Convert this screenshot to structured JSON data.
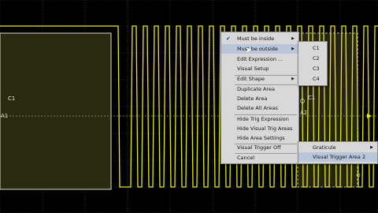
{
  "colors": {
    "background": "#000000",
    "grid": "#4a4a38",
    "signal": "#e8e820",
    "area_fill": "#2a2a10",
    "menu_bg": "#d8d8d8",
    "menu_highlight": "#b9c5d9"
  },
  "labels": {
    "area1_channel": "C1",
    "area1_marker": "A1",
    "area2_channel": "C1",
    "area2_marker": "A2"
  },
  "context_menu": {
    "items": [
      {
        "label": "Must be inside",
        "checked": true,
        "submenu": true
      },
      {
        "label": "Must be outside",
        "highlighted": true,
        "submenu": true
      },
      {
        "label": "Edit Expression ..."
      },
      {
        "label": "Visual Setup"
      },
      {
        "label": "Edit Shape",
        "submenu": true
      },
      {
        "label": "Duplicate Area"
      },
      {
        "label": "Delete Area"
      },
      {
        "label": "Delete All Areas"
      },
      {
        "label": "Hide Trig Expression"
      },
      {
        "label": "Hide Visual Trig Areas"
      },
      {
        "label": "Hide Area Settings"
      },
      {
        "label": "Visual Trigger Off"
      },
      {
        "label": "Cancel"
      }
    ]
  },
  "channel_submenu": {
    "items": [
      "C1",
      "C2",
      "C3",
      "C4"
    ]
  },
  "graticule_submenu": {
    "items": [
      {
        "label": "Graticule",
        "submenu": true
      },
      {
        "label": "Visual Trigger Area 2",
        "highlighted": true
      }
    ]
  }
}
